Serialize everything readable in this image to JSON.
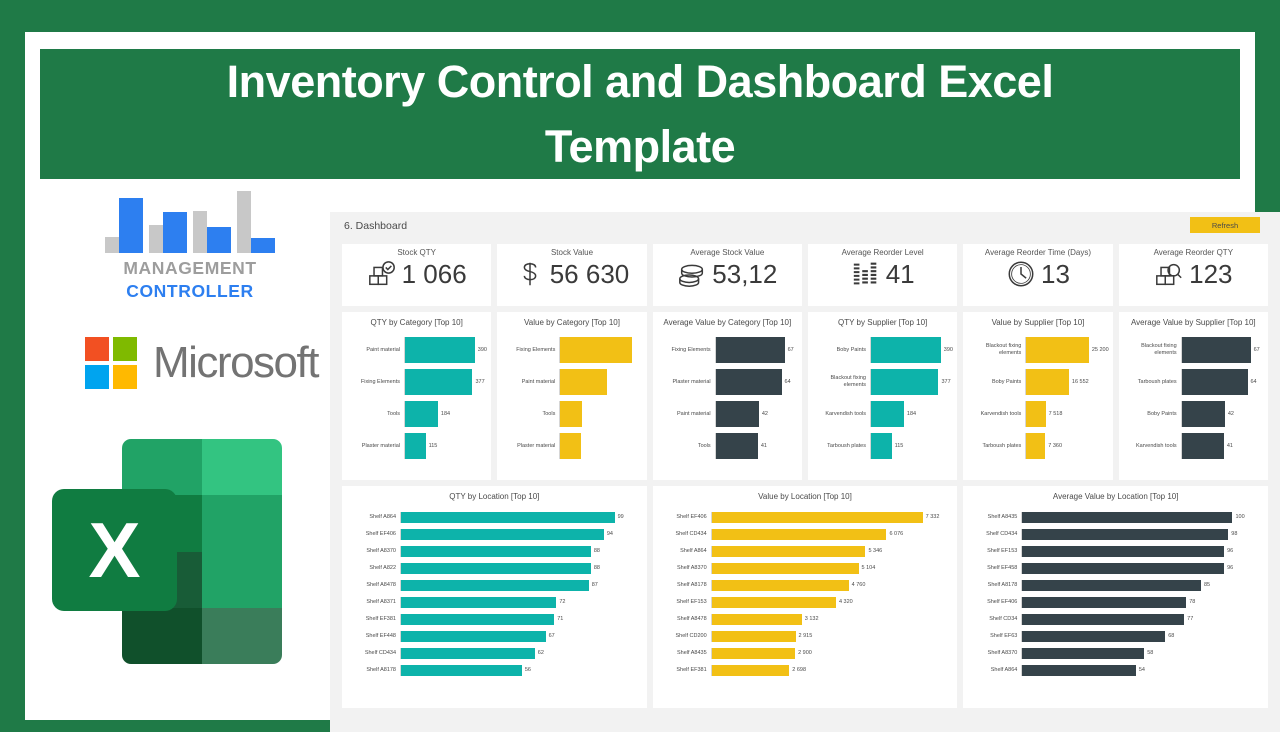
{
  "colors": {
    "green": "#1F7A47",
    "teal": "#0DB3AA",
    "yellow": "#F2C015",
    "dark": "#35434A",
    "blue": "#2D7FF0",
    "grey": "#C8C8C8"
  },
  "banner": {
    "title": "Inventory Control and Dashboard Excel Template"
  },
  "rail": {
    "management_controller": {
      "line1": "MANAGEMENT",
      "line2": "CONTROLLER"
    },
    "microsoft": {
      "word": "Microsoft"
    },
    "excel": {
      "letter": "X"
    }
  },
  "dashboard": {
    "sheet_title": "6. Dashboard",
    "refresh_label": "Refresh",
    "kpis": [
      {
        "label": "Stock QTY",
        "value": "1 066",
        "icon": "boxes-check-icon"
      },
      {
        "label": "Stock Value",
        "value": "56 630",
        "icon": "dollar-icon"
      },
      {
        "label": "Average Stock Value",
        "value": "53,12",
        "icon": "coins-icon"
      },
      {
        "label": "Average Reorder Level",
        "value": "41",
        "icon": "levels-icon"
      },
      {
        "label": "Average Reorder Time (Days)",
        "value": "13",
        "icon": "clock-icon"
      },
      {
        "label": "Average Reorder QTY",
        "value": "123",
        "icon": "boxes-search-icon"
      }
    ]
  },
  "chart_data": [
    {
      "type": "bar",
      "orientation": "horizontal",
      "title": "QTY by Category [Top 10]",
      "color": "#0DB3AA",
      "categories": [
        "Paint material",
        "Fixing Elements",
        "Tools",
        "Plaster material"
      ],
      "values": [
        390,
        377,
        184,
        115
      ],
      "labels": [
        "390",
        "377",
        "184",
        "115"
      ],
      "show_values": true,
      "xlabel": "",
      "ylabel": "",
      "xlim": [
        0,
        460
      ],
      "grid": false,
      "legend": false
    },
    {
      "type": "bar",
      "orientation": "horizontal",
      "title": "Value by Category [Top 10]",
      "color": "#F2C015",
      "categories": [
        "Fixing Elements",
        "Paint material",
        "Tools",
        "Plaster material"
      ],
      "values": [
        25200,
        16552,
        7518,
        7360
      ],
      "labels": [
        "",
        "",
        "",
        ""
      ],
      "show_values": false,
      "xlabel": "",
      "ylabel": "",
      "xlim": [
        0,
        29000
      ],
      "grid": false,
      "legend": false
    },
    {
      "type": "bar",
      "orientation": "horizontal",
      "title": "Average Value by Category [Top 10]",
      "color": "#35434A",
      "categories": [
        "Fixing Elements",
        "Plaster material",
        "Paint material",
        "Tools"
      ],
      "values": [
        67,
        64,
        42,
        41
      ],
      "labels": [
        "67",
        "64",
        "42",
        "41"
      ],
      "show_values": true,
      "xlabel": "",
      "ylabel": "",
      "xlim": [
        0,
        80
      ],
      "grid": false,
      "legend": false
    },
    {
      "type": "bar",
      "orientation": "horizontal",
      "title": "QTY by Supplier [Top 10]",
      "color": "#0DB3AA",
      "categories": [
        "Boby Paints",
        "Blackout fixing elements",
        "Karvendish tools",
        "Tarboush plates"
      ],
      "values": [
        390,
        377,
        184,
        115
      ],
      "labels": [
        "390",
        "377",
        "184",
        "115"
      ],
      "show_values": true,
      "xlabel": "",
      "ylabel": "",
      "xlim": [
        0,
        460
      ],
      "grid": false,
      "legend": false
    },
    {
      "type": "bar",
      "orientation": "horizontal",
      "title": "Value by Supplier [Top 10]",
      "color": "#F2C015",
      "categories": [
        "Blackout fixing elements",
        "Boby Paints",
        "Karvendish tools",
        "Tarboush plates"
      ],
      "values": [
        25200,
        16552,
        7518,
        7360
      ],
      "labels": [
        "25 200",
        "16 552",
        "7 518",
        "7 360"
      ],
      "show_values": true,
      "xlabel": "",
      "ylabel": "",
      "xlim": [
        0,
        32000
      ],
      "grid": false,
      "legend": false
    },
    {
      "type": "bar",
      "orientation": "horizontal",
      "title": "Average Value by Supplier [Top 10]",
      "color": "#35434A",
      "categories": [
        "Blackout fixing elements",
        "Tarboush plates",
        "Boby Paints",
        "Karvendish tools"
      ],
      "values": [
        67,
        64,
        42,
        41
      ],
      "labels": [
        "67",
        "64",
        "42",
        "41"
      ],
      "show_values": true,
      "xlabel": "",
      "ylabel": "",
      "xlim": [
        0,
        80
      ],
      "grid": false,
      "legend": false
    },
    {
      "type": "bar",
      "orientation": "horizontal",
      "title": "QTY by Location [Top 10]",
      "color": "#0DB3AA",
      "categories": [
        "Shelf A864",
        "Shelf EF406",
        "Shelf A8370",
        "Shelf A822",
        "Shelf A8478",
        "Shelf A8371",
        "Shelf EF381",
        "Shelf EF448",
        "Shelf CD434",
        "Shelf A8178"
      ],
      "values": [
        99,
        94,
        88,
        88,
        87,
        72,
        71,
        67,
        62,
        56
      ],
      "labels": [
        "99",
        "94",
        "88",
        "88",
        "87",
        "72",
        "71",
        "67",
        "62",
        "56"
      ],
      "show_values": true,
      "xlabel": "",
      "ylabel": "",
      "xlim": [
        0,
        112
      ],
      "grid": false,
      "legend": false
    },
    {
      "type": "bar",
      "orientation": "horizontal",
      "title": "Value by Location [Top 10]",
      "color": "#F2C015",
      "categories": [
        "Shelf EF406",
        "Shelf CD434",
        "Shelf A864",
        "Shelf A8370",
        "Shelf A8178",
        "Shelf EF153",
        "Shelf A8478",
        "Shelf CD200",
        "Shelf A8435",
        "Shelf EF381"
      ],
      "values": [
        7332,
        6076,
        5346,
        5104,
        4760,
        4320,
        3132,
        2915,
        2900,
        2698
      ],
      "labels": [
        "7 332",
        "6 076",
        "5 346",
        "5 104",
        "4 760",
        "4 320",
        "3 132",
        "2 915",
        "2 900",
        "2 698"
      ],
      "show_values": true,
      "xlabel": "",
      "ylabel": "",
      "xlim": [
        0,
        8400
      ],
      "grid": false,
      "legend": false
    },
    {
      "type": "bar",
      "orientation": "horizontal",
      "title": "Average Value by Location [Top 10]",
      "color": "#35434A",
      "categories": [
        "Shelf A8435",
        "Shelf CD434",
        "Shelf EF153",
        "Shelf EF458",
        "Shelf A8178",
        "Shelf EF406",
        "Shelf CD34",
        "Shelf EF63",
        "Shelf A8370",
        "Shelf A864"
      ],
      "values": [
        100,
        98,
        96,
        96,
        85,
        78,
        77,
        68,
        58,
        54
      ],
      "labels": [
        "100",
        "98",
        "96",
        "96",
        "85",
        "78",
        "77",
        "68",
        "58",
        "54"
      ],
      "show_values": true,
      "xlabel": "",
      "ylabel": "",
      "xlim": [
        0,
        115
      ],
      "grid": false,
      "legend": false
    }
  ]
}
